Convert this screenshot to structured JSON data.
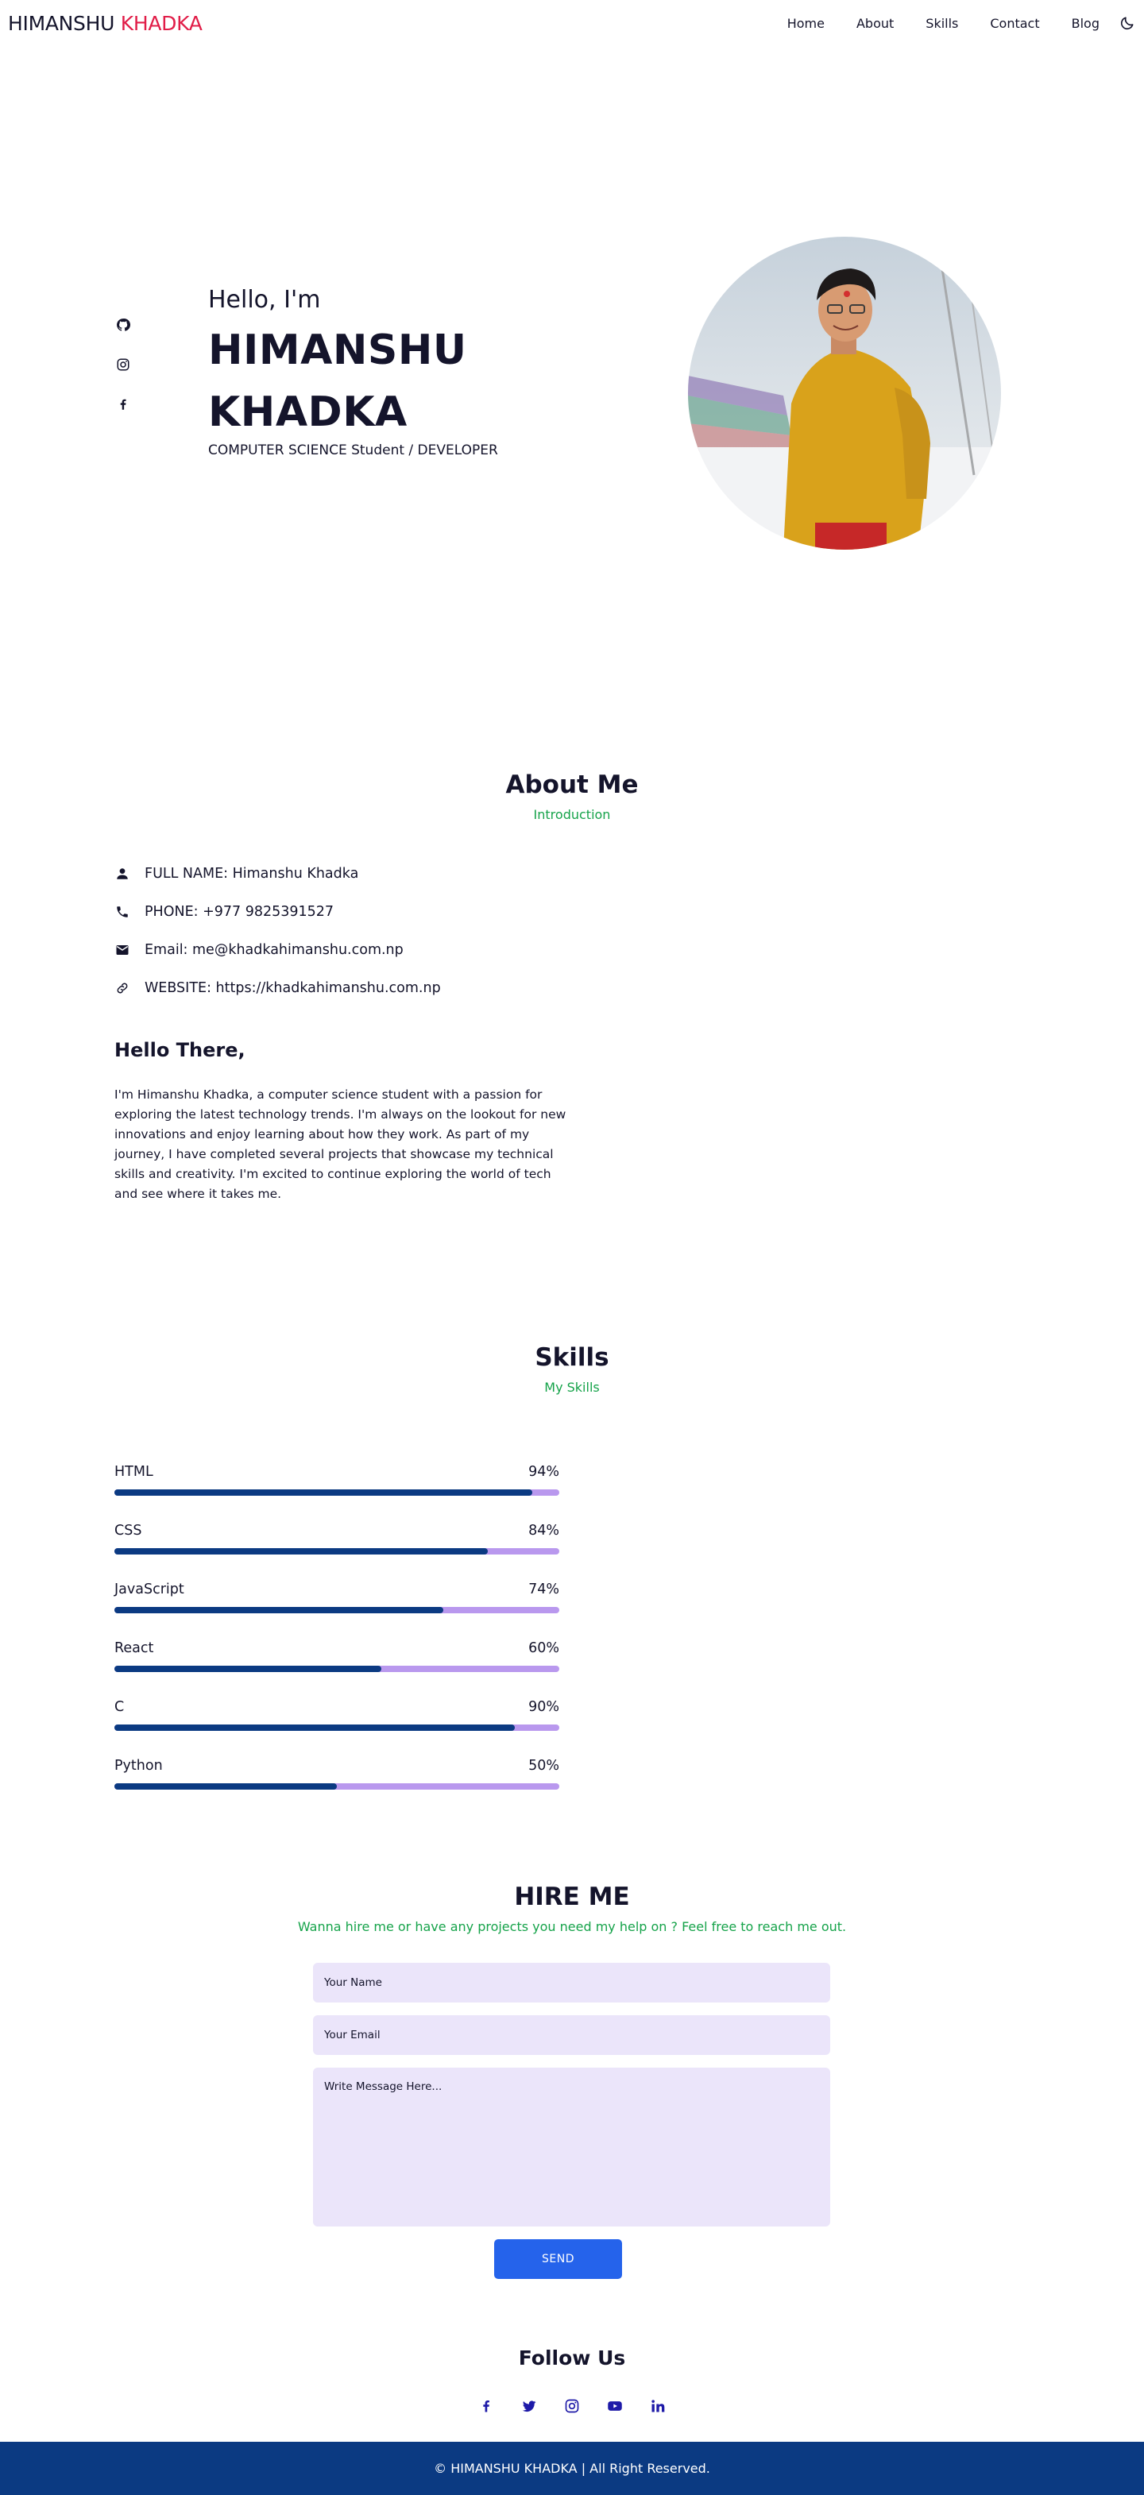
{
  "header": {
    "logo_first": "HIMANSHU",
    "logo_second": "KHADKA",
    "nav": [
      "Home",
      "About",
      "Skills",
      "Contact",
      "Blog"
    ],
    "theme_toggle_icon": "moon-icon"
  },
  "hero": {
    "greeting": "Hello, I'm",
    "name": "HIMANSHU KHADKA",
    "role": "COMPUTER SCIENCE Student / DEVELOPER",
    "socials": [
      "github-icon",
      "instagram-icon",
      "facebook-icon"
    ]
  },
  "about": {
    "title": "About Me",
    "subtitle": "Introduction",
    "info": [
      {
        "icon": "person-icon",
        "text": "FULL NAME: Himanshu Khadka"
      },
      {
        "icon": "phone-icon",
        "text": "PHONE: +977 9825391527"
      },
      {
        "icon": "mail-icon",
        "text": "Email: me@khadkahimanshu.com.np"
      },
      {
        "icon": "link-icon",
        "text": "WEBSITE: https://khadkahimanshu.com.np"
      }
    ],
    "heading": "Hello There,",
    "bio": "I'm Himanshu Khadka, a computer science student with a passion for exploring the latest technology trends. I'm always on the lookout for new innovations and enjoy learning about how they work. As part of my journey, I have completed several projects that showcase my technical skills and creativity. I'm excited to continue exploring the world of tech and see where it takes me."
  },
  "skills": {
    "title": "Skills",
    "subtitle": "My Skills",
    "items": [
      {
        "name": "HTML",
        "percent_label": "94%",
        "value": 94
      },
      {
        "name": "CSS",
        "percent_label": "84%",
        "value": 84
      },
      {
        "name": "JavaScript",
        "percent_label": "74%",
        "value": 74
      },
      {
        "name": "React",
        "percent_label": "60%",
        "value": 60
      },
      {
        "name": "C",
        "percent_label": "90%",
        "value": 90
      },
      {
        "name": "Python",
        "percent_label": "50%",
        "value": 50
      }
    ],
    "colors": {
      "fill": "#0b3a82",
      "track": "#b998ee"
    }
  },
  "hire": {
    "title": "HIRE ME",
    "subtitle": "Wanna hire me or have any projects you need my help on ? Feel free to reach me out.",
    "name_placeholder": "Your Name",
    "email_placeholder": "Your Email",
    "message_placeholder": "Write Message Here...",
    "send_label": "SEND"
  },
  "follow": {
    "title": "Follow Us",
    "icons": [
      "facebook-icon",
      "twitter-icon",
      "instagram-icon",
      "youtube-icon",
      "linkedin-icon"
    ]
  },
  "footer": {
    "text": "© HIMANSHU KHADKA | All Right Reserved."
  },
  "colors": {
    "accent": "#e11d48",
    "green": "#16a34a",
    "navy": "#0b3a82",
    "button": "#2563eb",
    "field_bg": "#ebe5fa"
  }
}
